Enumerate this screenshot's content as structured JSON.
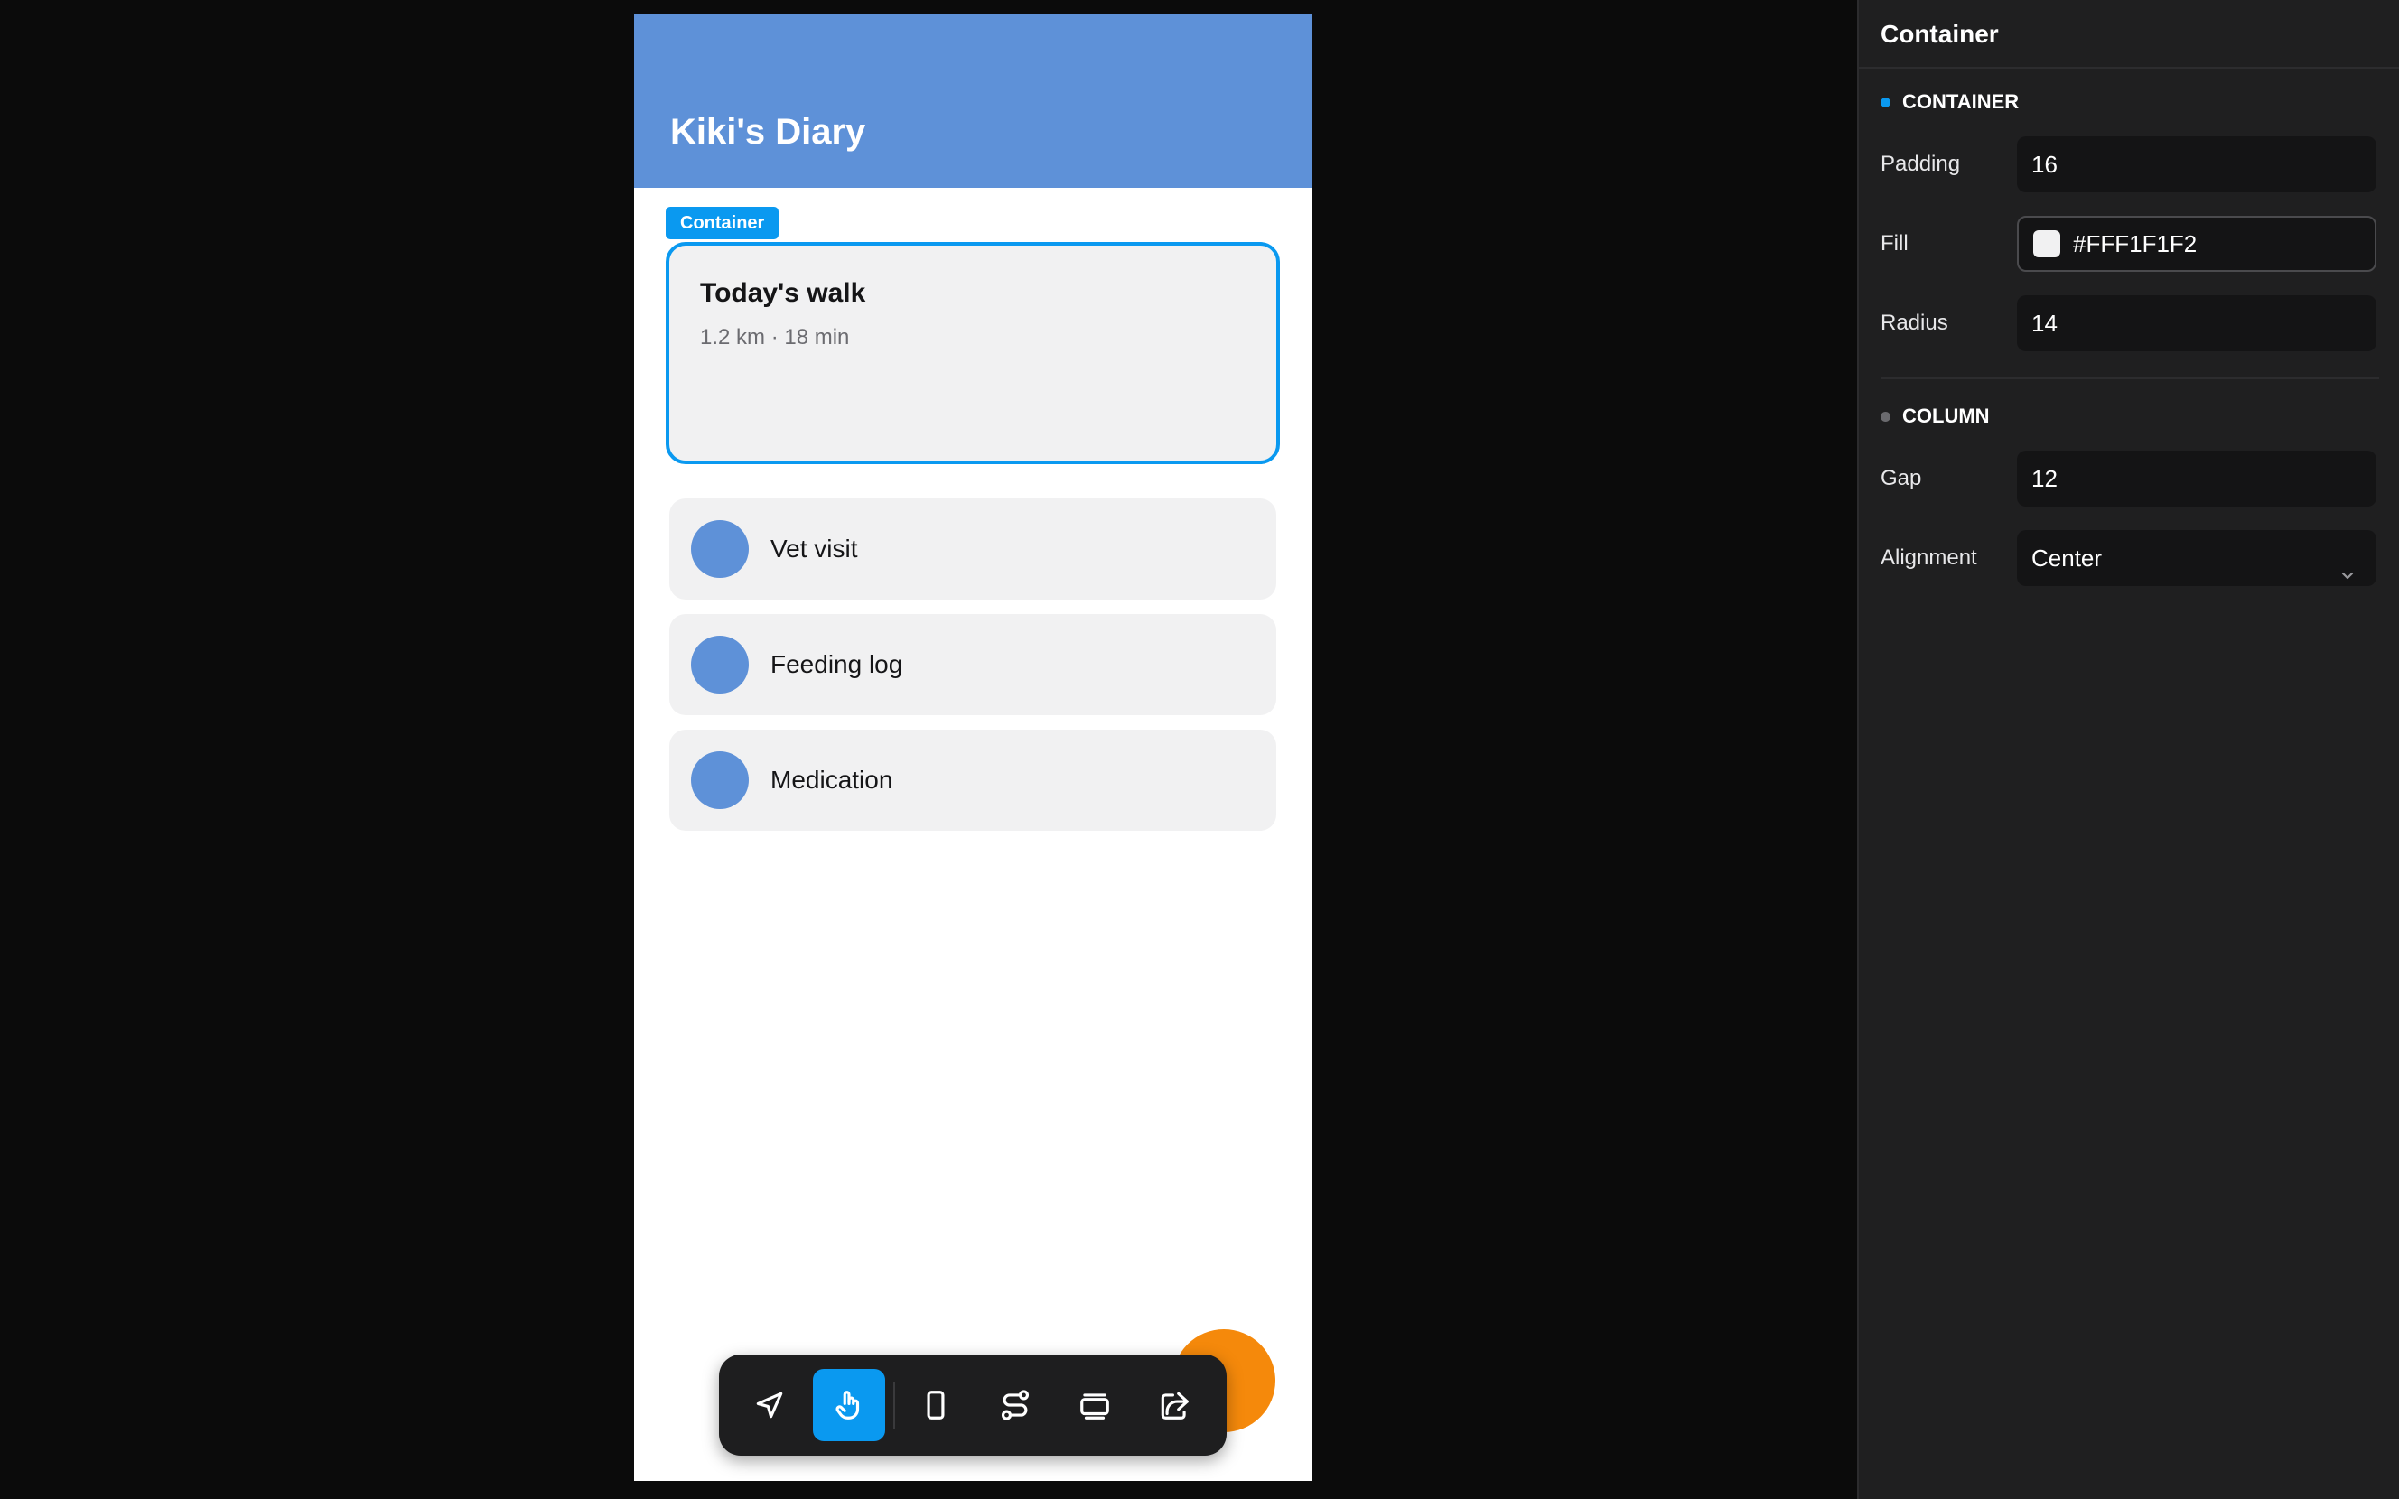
{
  "phone": {
    "title": "Kiki's Diary",
    "selection_tag": "Container",
    "card": {
      "title": "Today's walk",
      "subtitle": "1.2 km · 18 min"
    },
    "items": [
      {
        "label": "Vet visit"
      },
      {
        "label": "Feeding log"
      },
      {
        "label": "Medication"
      }
    ]
  },
  "toolbar": {
    "tools": [
      {
        "name": "navigate-tool",
        "icon": "navigation-arrow-icon",
        "active": false
      },
      {
        "name": "interact-tool",
        "icon": "hand-pointer-icon",
        "active": true
      },
      {
        "name": "frame-tool",
        "icon": "phone-frame-icon",
        "active": false
      },
      {
        "name": "flow-tool",
        "icon": "flow-path-icon",
        "active": false
      },
      {
        "name": "component-tool",
        "icon": "stacked-cards-icon",
        "active": false
      },
      {
        "name": "share-tool",
        "icon": "share-icon",
        "active": false
      }
    ]
  },
  "inspector": {
    "title": "Container",
    "container_section": {
      "heading": "CONTAINER",
      "padding_label": "Padding",
      "padding_value": "16",
      "fill_label": "Fill",
      "fill_value": "#FFF1F1F2",
      "radius_label": "Radius",
      "radius_value": "14"
    },
    "column_section": {
      "heading": "COLUMN",
      "gap_label": "Gap",
      "gap_value": "12",
      "alignment_label": "Alignment",
      "alignment_value": "Center"
    }
  },
  "colors": {
    "header": "#5e91d8",
    "selection": "#0a99f0",
    "fab": "#f5890b",
    "card_fill": "#f1f1f2"
  }
}
